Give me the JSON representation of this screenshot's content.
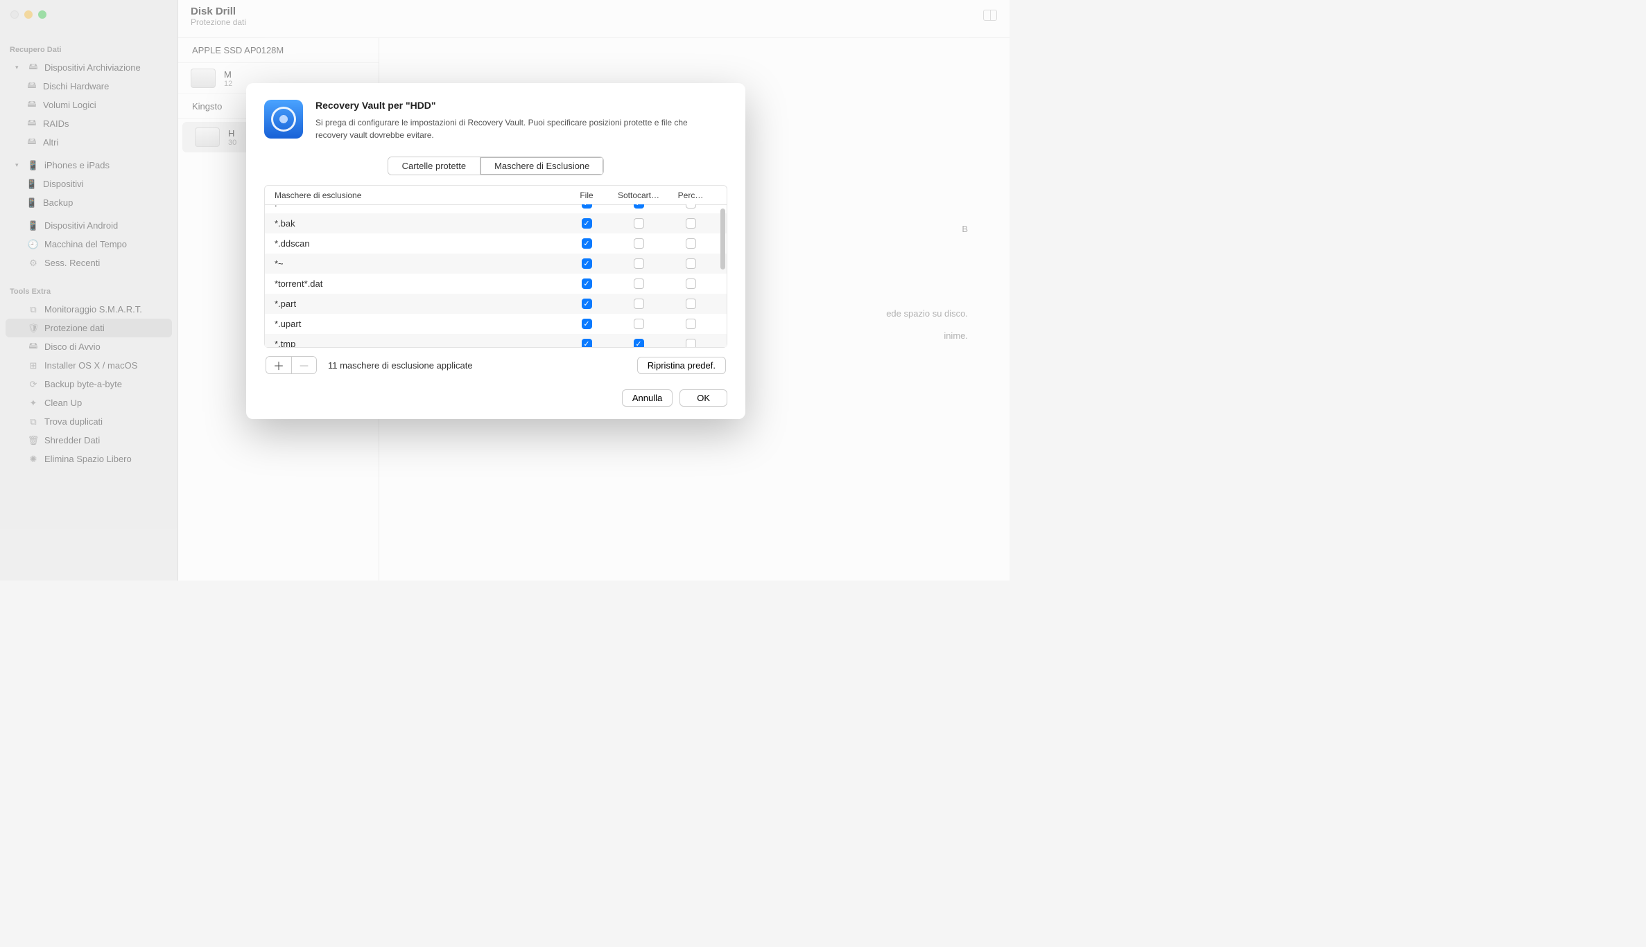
{
  "header": {
    "title": "Disk Drill",
    "subtitle": "Protezione dati"
  },
  "sidebar": {
    "section1_title": "Recupero Dati",
    "group1": {
      "label": "Dispositivi Archiviazione",
      "items": [
        "Dischi Hardware",
        "Volumi Logici",
        "RAIDs",
        "Altri"
      ]
    },
    "group2": {
      "label": "iPhones e iPads",
      "items": [
        "Dispositivi",
        "Backup"
      ]
    },
    "flat": [
      "Dispositivi Android",
      "Macchina del Tempo",
      "Sess. Recenti"
    ],
    "section2_title": "Tools Extra",
    "tools": [
      "Monitoraggio S.M.A.R.T.",
      "Protezione dati",
      "Disco di Avvio",
      "Installer OS X / macOS",
      "Backup byte-a-byte",
      "Clean Up",
      "Trova duplicati",
      "Shredder Dati",
      "Elimina Spazio Libero"
    ],
    "tools_selected_index": 1
  },
  "drive_list": {
    "group1": "APPLE SSD AP0128M",
    "drive1": {
      "name": "M",
      "sub": "12"
    },
    "group2": "Kingsto",
    "drive2": {
      "name": "H",
      "sub": "30"
    }
  },
  "detail": {
    "line1": "B",
    "line2": "ede spazio su disco.",
    "line3": "inime."
  },
  "modal": {
    "title": "Recovery Vault per \"HDD\"",
    "desc": "Si prega di configurare le impostazioni di Recovery Vault. Puoi specificare posizioni protette e file che recovery vault dovrebbe evitare.",
    "tabs": [
      "Cartelle protette",
      "Maschere di Esclusione"
    ],
    "active_tab": 1,
    "columns": [
      "Maschere di esclusione",
      "File",
      "Sottocart…",
      "Perc…"
    ],
    "rows": [
      {
        "mask": ".",
        "file": true,
        "sub": true,
        "perc": false
      },
      {
        "mask": "*.bak",
        "file": true,
        "sub": false,
        "perc": false
      },
      {
        "mask": "*.ddscan",
        "file": true,
        "sub": false,
        "perc": false
      },
      {
        "mask": "*~",
        "file": true,
        "sub": false,
        "perc": false
      },
      {
        "mask": "*torrent*.dat",
        "file": true,
        "sub": false,
        "perc": false
      },
      {
        "mask": "*.part",
        "file": true,
        "sub": false,
        "perc": false
      },
      {
        "mask": "*.upart",
        "file": true,
        "sub": false,
        "perc": false
      },
      {
        "mask": "*.tmp",
        "file": true,
        "sub": true,
        "perc": false
      }
    ],
    "count_label": "11 maschere di esclusione applicate",
    "reset_label": "Ripristina predef.",
    "cancel_label": "Annulla",
    "ok_label": "OK"
  }
}
